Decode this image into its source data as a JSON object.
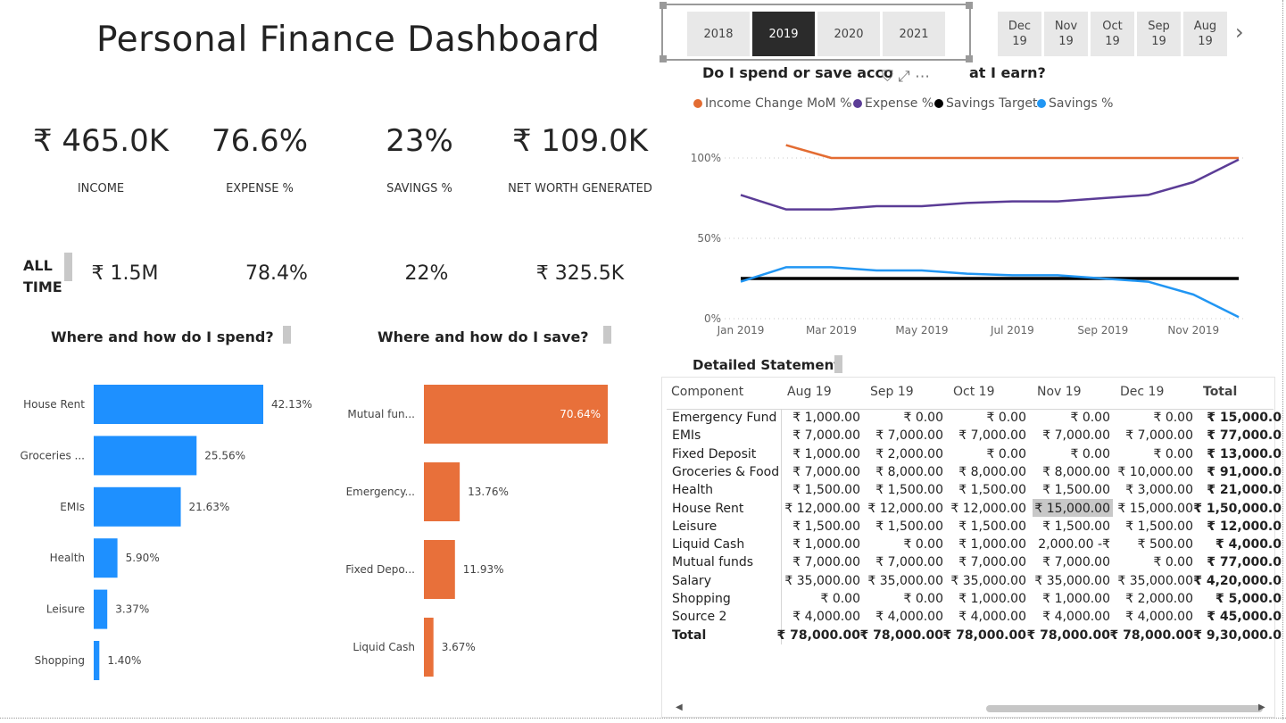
{
  "title": "Personal Finance Dashboard",
  "kpis": [
    {
      "value": "₹ 465.0K",
      "label": "INCOME"
    },
    {
      "value": "76.6%",
      "label": "EXPENSE %"
    },
    {
      "value": "23%",
      "label": "SAVINGS %"
    },
    {
      "value": "₹ 109.0K",
      "label": "NET WORTH GENERATED"
    }
  ],
  "all_time": {
    "label_line1": "ALL",
    "label_line2": "TIME",
    "values": [
      "₹ 1.5M",
      "78.4%",
      "22%",
      "₹ 325.5K"
    ]
  },
  "year_slicer": {
    "years": [
      "2018",
      "2019",
      "2020",
      "2021"
    ],
    "selected": "2019"
  },
  "month_slicer": {
    "months": [
      {
        "m": "Dec",
        "y": "19"
      },
      {
        "m": "Nov",
        "y": "19"
      },
      {
        "m": "Oct",
        "y": "19"
      },
      {
        "m": "Sep",
        "y": "19"
      },
      {
        "m": "Aug",
        "y": "19"
      }
    ],
    "next_glyph": "›"
  },
  "line_chart": {
    "title_start": "Do I spend or save acco",
    "title_end": "at I earn?",
    "icons": "⛉ ⤢ ⋯"
  },
  "colors": {
    "income": "#e36c32",
    "expense": "#5b3c96",
    "target": "#000000",
    "savings": "#2196f3",
    "spend_bar": "#1e90ff",
    "save_bar": "#e8703a"
  },
  "spend_section": {
    "title": "Where and how do I spend?"
  },
  "save_section": {
    "title": "Where and how do I save?"
  },
  "table": {
    "title": "Detailed Statement",
    "columns": [
      "Component",
      "Aug 19",
      "Sep 19",
      "Oct 19",
      "Nov 19",
      "Dec 19",
      "Total"
    ],
    "rows": [
      [
        "Emergency Fund",
        "₹ 1,000.00",
        "₹ 0.00",
        "₹ 0.00",
        "₹ 0.00",
        "₹ 0.00",
        "₹ 15,000.0"
      ],
      [
        "EMIs",
        "₹ 7,000.00",
        "₹ 7,000.00",
        "₹ 7,000.00",
        "₹ 7,000.00",
        "₹ 7,000.00",
        "₹ 77,000.0"
      ],
      [
        "Fixed Deposit",
        "₹ 1,000.00",
        "₹ 2,000.00",
        "₹ 0.00",
        "₹ 0.00",
        "₹ 0.00",
        "₹ 13,000.0"
      ],
      [
        "Groceries & Food",
        "₹ 7,000.00",
        "₹ 8,000.00",
        "₹ 8,000.00",
        "₹ 8,000.00",
        "₹ 10,000.00",
        "₹ 91,000.0"
      ],
      [
        "Health",
        "₹ 1,500.00",
        "₹ 1,500.00",
        "₹ 1,500.00",
        "₹ 1,500.00",
        "₹ 3,000.00",
        "₹ 21,000.0"
      ],
      [
        "House Rent",
        "₹ 12,000.00",
        "₹ 12,000.00",
        "₹ 12,000.00",
        "₹ 15,000.00",
        "₹ 15,000.00",
        "₹ 1,50,000.0"
      ],
      [
        "Leisure",
        "₹ 1,500.00",
        "₹ 1,500.00",
        "₹ 1,500.00",
        "₹ 1,500.00",
        "₹ 1,500.00",
        "₹ 12,000.0"
      ],
      [
        "Liquid Cash",
        "₹ 1,000.00",
        "₹ 0.00",
        "₹ 1,000.00",
        "2,000.00 -₹",
        "₹ 500.00",
        "₹ 4,000.0"
      ],
      [
        "Mutual funds",
        "₹ 7,000.00",
        "₹ 7,000.00",
        "₹ 7,000.00",
        "₹ 7,000.00",
        "₹ 0.00",
        "₹ 77,000.0"
      ],
      [
        "Salary",
        "₹ 35,000.00",
        "₹ 35,000.00",
        "₹ 35,000.00",
        "₹ 35,000.00",
        "₹ 35,000.00",
        "₹ 4,20,000.0"
      ],
      [
        "Shopping",
        "₹ 0.00",
        "₹ 0.00",
        "₹ 1,000.00",
        "₹ 1,000.00",
        "₹ 2,000.00",
        "₹ 5,000.0"
      ],
      [
        "Source 2",
        "₹ 4,000.00",
        "₹ 4,000.00",
        "₹ 4,000.00",
        "₹ 4,000.00",
        "₹ 4,000.00",
        "₹ 45,000.0"
      ]
    ],
    "total_row": [
      "Total",
      "₹ 78,000.00",
      "₹ 78,000.00",
      "₹ 78,000.00",
      "₹ 78,000.00",
      "₹ 78,000.00",
      "₹ 9,30,000.0"
    ],
    "highlighted": {
      "row": 5,
      "col": 4
    }
  },
  "chart_data": [
    {
      "type": "line",
      "title": "Do I spend or save according to what I earn?",
      "x": [
        "Jan 2019",
        "Feb 2019",
        "Mar 2019",
        "Apr 2019",
        "May 2019",
        "Jun 2019",
        "Jul 2019",
        "Aug 2019",
        "Sep 2019",
        "Oct 2019",
        "Nov 2019",
        "Dec 2019"
      ],
      "x_tick_labels": [
        "Jan 2019",
        "Mar 2019",
        "May 2019",
        "Jul 2019",
        "Sep 2019",
        "Nov 2019"
      ],
      "y_tick_labels": [
        "100%",
        "50%",
        "0%"
      ],
      "ylim": [
        0,
        100
      ],
      "series": [
        {
          "name": "Income Change MoM %",
          "values": [
            null,
            108,
            100,
            100,
            100,
            100,
            100,
            100,
            100,
            100,
            100,
            100
          ]
        },
        {
          "name": "Expense %",
          "values": [
            77,
            68,
            68,
            70,
            70,
            72,
            73,
            73,
            75,
            77,
            85,
            99
          ]
        },
        {
          "name": "Savings Target",
          "values": [
            25,
            25,
            25,
            25,
            25,
            25,
            25,
            25,
            25,
            25,
            25,
            25
          ]
        },
        {
          "name": "Savings %",
          "values": [
            23,
            32,
            32,
            30,
            30,
            28,
            27,
            27,
            25,
            23,
            15,
            1
          ]
        }
      ],
      "legend": "top-left",
      "grid": "dotted horizontal"
    },
    {
      "type": "bar",
      "orientation": "horizontal",
      "title": "Where and how do I spend?",
      "categories": [
        "House Rent",
        "Groceries ...",
        "EMIs",
        "Health",
        "Leisure",
        "Shopping"
      ],
      "values": [
        42.13,
        25.56,
        21.63,
        5.9,
        3.37,
        1.4
      ],
      "data_labels": [
        "42.13%",
        "25.56%",
        "21.63%",
        "5.90%",
        "3.37%",
        "1.40%"
      ]
    },
    {
      "type": "bar",
      "orientation": "horizontal",
      "title": "Where and how do I save?",
      "categories": [
        "Mutual fun...",
        "Emergency...",
        "Fixed Depo...",
        "Liquid Cash"
      ],
      "values": [
        70.64,
        13.76,
        11.93,
        3.67
      ],
      "data_labels": [
        "70.64%",
        "13.76%",
        "11.93%",
        "3.67%"
      ]
    }
  ]
}
